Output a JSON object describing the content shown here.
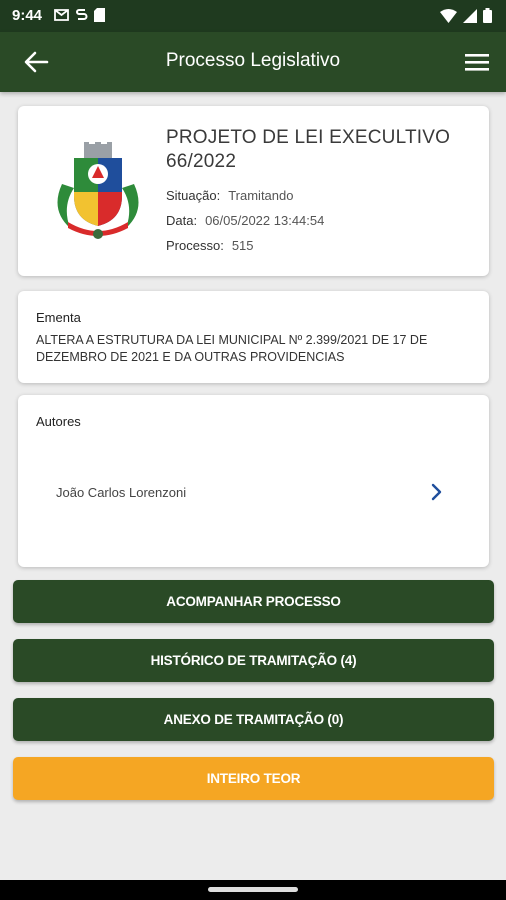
{
  "status": {
    "time": "9:44"
  },
  "appbar": {
    "title": "Processo Legislativo"
  },
  "process": {
    "title": "PROJETO DE LEI EXECULTIVO 66/2022",
    "situacao_label": "Situação:",
    "situacao_value": "Tramitando",
    "data_label": "Data:",
    "data_value": "06/05/2022 13:44:54",
    "processo_label": "Processo:",
    "processo_value": "515"
  },
  "ementa": {
    "label": "Ementa",
    "text": "ALTERA A ESTRUTURA DA LEI MUNICIPAL Nº 2.399/2021 DE 17 DE DEZEMBRO DE 2021 E DA OUTRAS PROVIDENCIAS"
  },
  "autores": {
    "label": "Autores",
    "items": [
      {
        "name": "João Carlos Lorenzoni"
      }
    ]
  },
  "buttons": {
    "acompanhar": "ACOMPANHAR PROCESSO",
    "historico": "HISTÓRICO DE TRAMITAÇÃO (4)",
    "anexo": "ANEXO DE TRAMITAÇÃO (0)",
    "inteiro": "INTEIRO TEOR"
  },
  "colors": {
    "primary": "#2a4a26",
    "accent": "#f5a623",
    "statusbar": "#1f3a1f"
  },
  "icons": {
    "back": "arrow-left-icon",
    "menu": "hamburger-menu-icon",
    "author_chevron": "chevron-right-icon"
  }
}
